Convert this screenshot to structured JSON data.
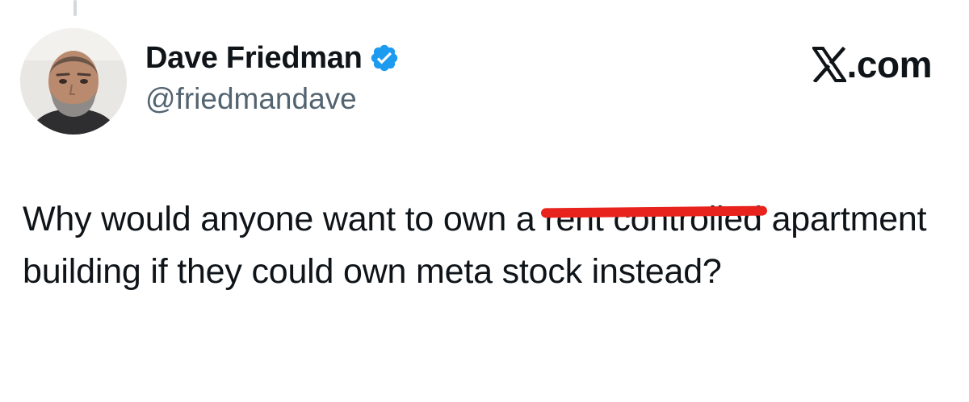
{
  "author": {
    "display_name": "Dave Friedman",
    "handle": "@friedmandave",
    "verified": true,
    "verified_icon": "verified-badge-icon",
    "verified_color": "#1d9bf0"
  },
  "brand": {
    "logo_icon": "x-logo-icon",
    "label": ".com"
  },
  "tweet": {
    "text_before": "Why would anyone want to own a ",
    "struck_text": "rent controlled",
    "text_after": " apartment building if they could own meta stock instead?",
    "strike_color": "#e8231e"
  },
  "colors": {
    "text": "#0f1419",
    "secondary_text": "#536471",
    "thread_line": "#cfd9de"
  }
}
